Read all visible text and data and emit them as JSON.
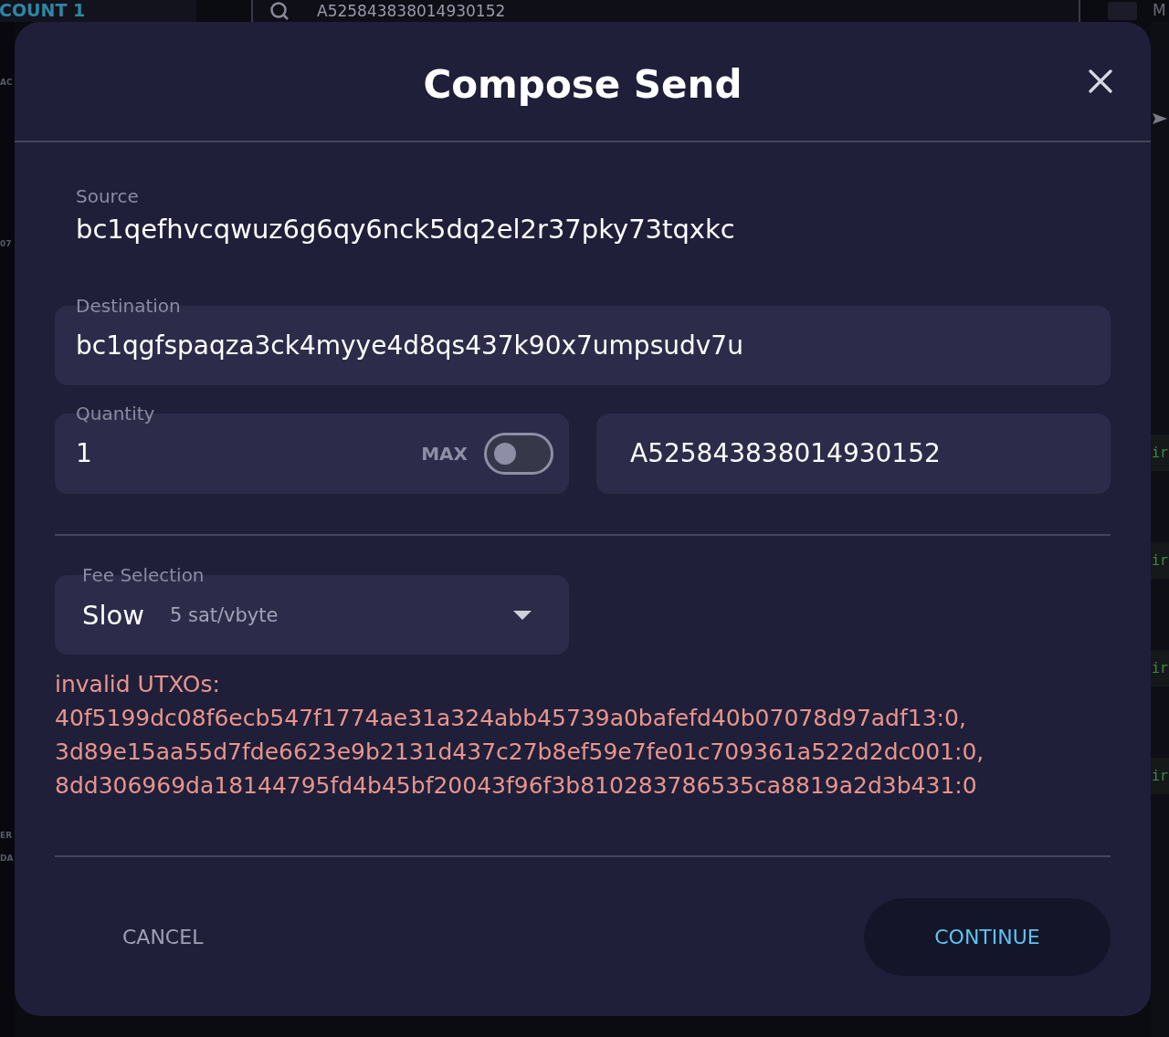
{
  "background": {
    "account": "COUNT 1",
    "search": {
      "value": "A525843838014930152"
    },
    "corner_text": "M",
    "left_fragments": [
      "AC",
      "07",
      "ER",
      "DA"
    ],
    "right_fragments": [
      "ir",
      "ir",
      "ir",
      "ir"
    ]
  },
  "dialog": {
    "title": "Compose Send",
    "source": {
      "label": "Source",
      "value": "bc1qefhvcqwuz6g6qy6nck5dq2el2r37pky73tqxkc"
    },
    "destination": {
      "label": "Destination",
      "value": "bc1qgfspaqza3ck4myye4d8qs437k90x7umpsudv7u"
    },
    "quantity": {
      "label": "Quantity",
      "value": "1",
      "max_label": "MAX",
      "max_enabled": false
    },
    "asset": {
      "value": "A525843838014930152"
    },
    "fee": {
      "label": "Fee Selection",
      "speed": "Slow",
      "rate": "5 sat/vbyte"
    },
    "error": "invalid UTXOs: 40f5199dc08f6ecb547f1774ae31a324abb45739a0bafefd40b07078d97adf13:0, 3d89e15aa55d7fde6623e9b2131d437c27b8ef59e7fe01c709361a522d2dc001:0, 8dd306969da18144795fd4b45bf20043f96f3b810283786535ca8819a2d3b431:0",
    "buttons": [
      {
        "label": "CANCEL",
        "kind": "text"
      },
      {
        "label": "CONTINUE",
        "kind": "filled"
      }
    ]
  }
}
